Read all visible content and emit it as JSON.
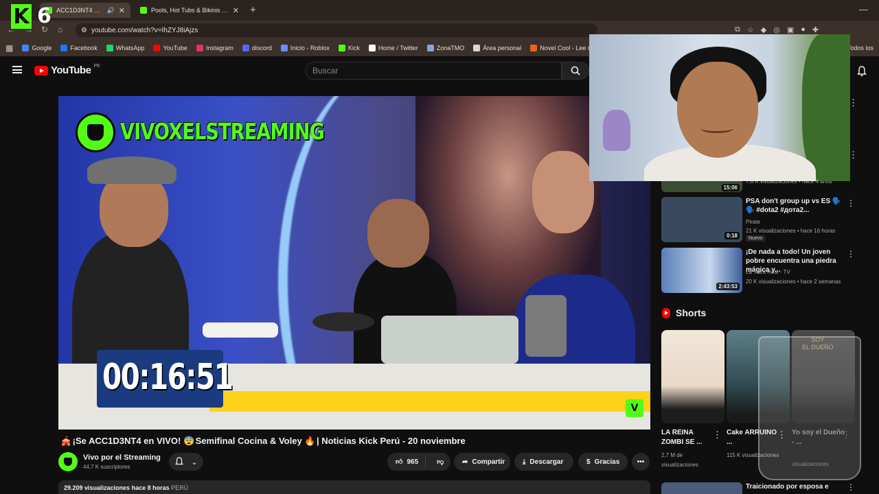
{
  "browser": {
    "kick_counter": "6",
    "tabs": [
      {
        "label": "ACC1D3NT4 en VIVO",
        "active": true
      },
      {
        "label": "Pools, Hot Tubs & Bikinis Stream",
        "active": false
      }
    ],
    "url": "youtube.com/watch?v=IhZYJ8iAjzs",
    "bookmarks": [
      {
        "label": "Google",
        "color": "#4285f4"
      },
      {
        "label": "Facebook",
        "color": "#1877f2"
      },
      {
        "label": "WhatsApp",
        "color": "#25d366"
      },
      {
        "label": "YouTube",
        "color": "#ff0000"
      },
      {
        "label": "Instagram",
        "color": "#e1306c"
      },
      {
        "label": "discord",
        "color": "#5865f2"
      },
      {
        "label": "Inicio - Roblox",
        "color": "#6a8cff"
      },
      {
        "label": "Kick",
        "color": "#53fc18"
      },
      {
        "label": "Home / Twitter",
        "color": "#ffffff"
      },
      {
        "label": "ZonaTMO",
        "color": "#8aa4d6"
      },
      {
        "label": "Área personal",
        "color": "#d6d6d6"
      },
      {
        "label": "Novel Cool - Lee no...",
        "color": "#e8641b"
      }
    ],
    "bookmarks_right": "Todos los"
  },
  "youtube": {
    "logo_text": "YouTube",
    "region": "PE",
    "search_placeholder": "Buscar"
  },
  "player": {
    "overlay_brand": "VIVOXELSTREAMING",
    "timer": "00:16:51"
  },
  "video": {
    "title_icon_left": "🎪",
    "title_part1": "¡Se ACC1D3NT4 en VIVO!",
    "title_icon_mid": "😨",
    "title_part2": "Semifinal Cocina & Voley",
    "title_icon_fire": "🔥",
    "title_part3": "| Noticias Kick Perú - 20 noviembre",
    "channel": "Vivo por el Streaming",
    "subscribers": "44,7 K suscriptores",
    "likes": "965",
    "share": "Compartir",
    "download": "Descargar",
    "thanks": "Gracias",
    "views": "29.209 visualizaciones",
    "age": "hace 8 horas",
    "country": "PERÚ"
  },
  "sidebar": {
    "partial_duration": "15:06",
    "partial_meta": "7,6 K visualizaciones • hace 4 años",
    "recommendations": [
      {
        "title": "PSA don't group up vs ES 🗣️🗣️ #dota2 #дота2...",
        "channel": "Pirate",
        "meta": "21 K visualizaciones • hace 16 horas",
        "badge": "Nuevo",
        "duration": "0:18",
        "thumb_color": "#3a4a5e"
      },
      {
        "title": "¡De nada a todo! Un joven pobre encuentra una piedra mágica y...",
        "channel": "La Tiara Real - TV",
        "meta": "20 K visualizaciones • hace 2 semanas",
        "badge": "",
        "duration": "2:43:53",
        "thumb_color": "#5a7fb8"
      }
    ],
    "shorts_heading": "Shorts",
    "shorts": [
      {
        "title": "LA REINA ZOMBI SE ...",
        "views": "2,7 M de visualizaciones",
        "thumb_color": "#e9d9c8"
      },
      {
        "title": "Cake ARRUINO ...",
        "views": "115 K visualizaciones",
        "thumb_color": "#2f4a4f"
      },
      {
        "title": "Yo soy el Dueño - ...",
        "views": "visualizaciones",
        "thumb_color": "#3b3b3b"
      }
    ],
    "glass_text_line1": "SOY",
    "glass_text_line2": "EL DUEÑO",
    "bottom_title": "Traicionado por esposa e"
  }
}
